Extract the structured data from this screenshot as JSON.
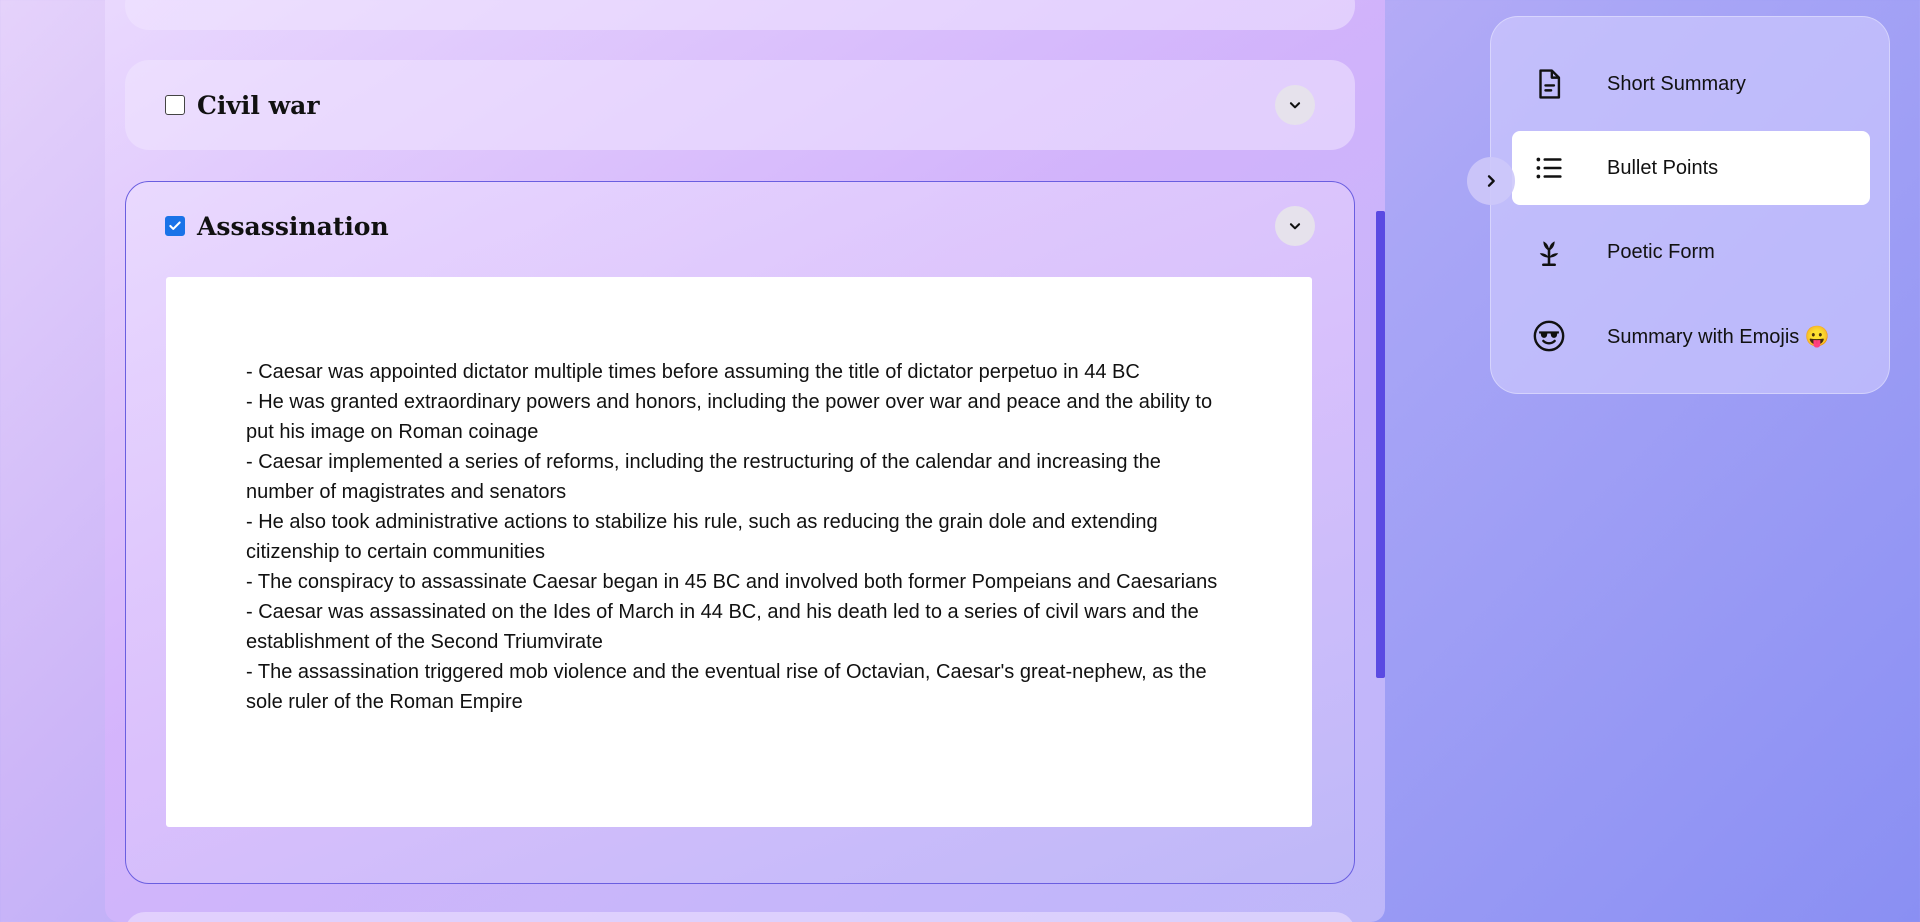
{
  "sections": {
    "civil_war": {
      "title": "Civil war",
      "checked": false
    },
    "assassination": {
      "title": "Assassination",
      "checked": true,
      "bullets": [
        "- Caesar was appointed dictator multiple times before assuming the title of dictator perpetuo in 44 BC",
        "- He was granted extraordinary powers and honors, including the power over war and peace and the ability to put his image on Roman coinage",
        "- Caesar implemented a series of reforms, including the restructuring of the calendar and increasing the number of magistrates and senators",
        "- He also took administrative actions to stabilize his rule, such as reducing the grain dole and extending citizenship to certain communities",
        "- The conspiracy to assassinate Caesar began in 45 BC and involved both former Pompeians and Caesarians",
        "- Caesar was assassinated on the Ides of March in 44 BC, and his death led to a series of civil wars and the establishment of the Second Triumvirate",
        "- The assassination triggered mob violence and the eventual rise of Octavian, Caesar's great-nephew, as the sole ruler of the Roman Empire"
      ]
    }
  },
  "side_menu": {
    "items": [
      {
        "label": "Short Summary",
        "icon": "document-icon",
        "active": false
      },
      {
        "label": "Bullet Points",
        "icon": "list-icon",
        "active": true
      },
      {
        "label": "Poetic Form",
        "icon": "sprout-icon",
        "active": false
      },
      {
        "label": "Summary with Emojis 😛",
        "icon": "sunglasses-face-icon",
        "active": false
      }
    ],
    "toggle_icon": "chevron-right-icon"
  },
  "colors": {
    "accent": "#5a4ae2",
    "card_border": "#6a5ee0",
    "checkbox_checked": "#1a73e8"
  }
}
